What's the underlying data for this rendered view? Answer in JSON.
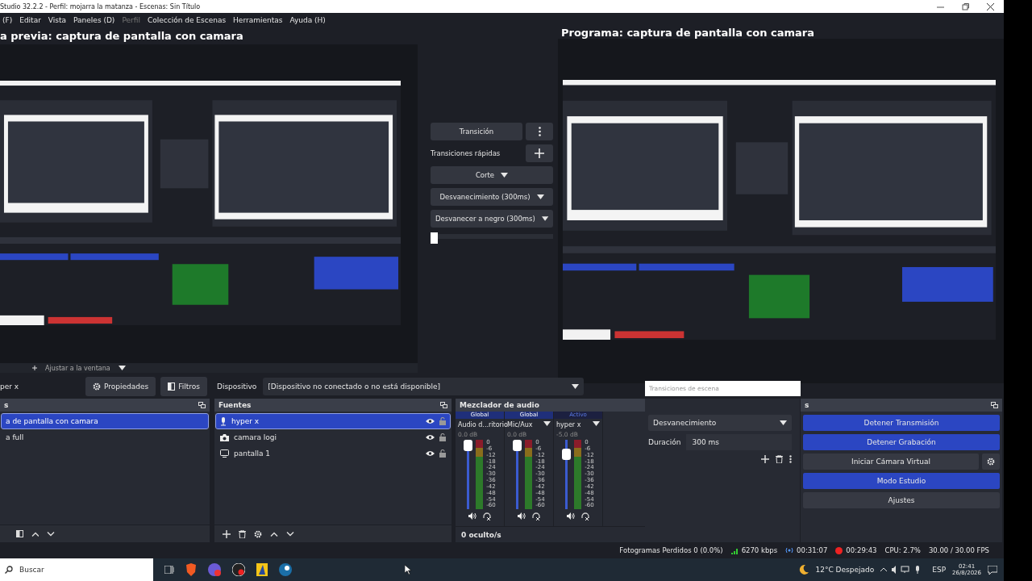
{
  "window": {
    "title": "Studio 32.2.2 - Perfil: mojarra la matanza - Escenas: Sin Título"
  },
  "menu": [
    {
      "label": "(F)",
      "disabled": false
    },
    {
      "label": "Editar",
      "disabled": false
    },
    {
      "label": "Vista",
      "disabled": false
    },
    {
      "label": "Paneles (D)",
      "disabled": false
    },
    {
      "label": "Perfil",
      "disabled": true
    },
    {
      "label": "Colección de Escenas",
      "disabled": false
    },
    {
      "label": "Herramientas",
      "disabled": false
    },
    {
      "label": "Ayuda (H)",
      "disabled": false
    }
  ],
  "preview": {
    "title": "a previa: captura de pantalla con camara"
  },
  "program": {
    "title": "Programa: captura de pantalla con camara"
  },
  "transition_panel": {
    "button": "Transición",
    "quick_label": "Transiciones rápidas",
    "quick": [
      "Corte",
      "Desvanecimiento (300ms)",
      "Desvanecer a negro (300ms)"
    ],
    "tbar": {
      "level": 0
    }
  },
  "preview_toolbar": {
    "zoom": "Ajustar a la ventana"
  },
  "source_toolbar": {
    "source": "per x",
    "buttons": [
      {
        "kind": "properties",
        "label": "Propiedades"
      },
      {
        "kind": "filters",
        "label": "Filtros"
      }
    ],
    "device_label": "Dispositivo",
    "device_value": "[Dispositivo no conectado o no está disponible]"
  },
  "scenes": {
    "title": "s",
    "items": [
      {
        "name": "a de pantalla con camara",
        "selected": true
      },
      {
        "name": "a full",
        "selected": false
      }
    ]
  },
  "sources": {
    "title": "Fuentes",
    "items": [
      {
        "name": "hyper x",
        "kind": "microphone",
        "selected": true
      },
      {
        "name": "camara logi",
        "kind": "camera",
        "selected": false
      },
      {
        "name": "pantalla 1",
        "kind": "monitor",
        "selected": false
      }
    ]
  },
  "mixer": {
    "title": "Mezclador de audio",
    "hidden": "0 oculto/s",
    "channels": [
      {
        "mode": "Global",
        "active": false,
        "name": "Audio d...ritorio",
        "reading": "0.0 dB",
        "level": 1.0,
        "scale": [
          "0",
          "-6",
          "-12",
          "-18",
          "-24",
          "-30",
          "-36",
          "-42",
          "-48",
          "-54",
          "-60"
        ]
      },
      {
        "mode": "Global",
        "active": false,
        "name": "Mic/Aux",
        "reading": "0.0 dB",
        "level": 1.0,
        "scale": [
          "0",
          "-6",
          "-12",
          "-18",
          "-24",
          "-30",
          "-36",
          "-42",
          "-48",
          "-54",
          "-60"
        ]
      },
      {
        "mode": "Activo",
        "active": true,
        "name": "hyper x",
        "reading": "-5.0 dB",
        "level": 0.85,
        "scale": [
          "0",
          "-6",
          "-12",
          "-18",
          "-24",
          "-30",
          "-36",
          "-42",
          "-48",
          "-54",
          "-60"
        ]
      }
    ]
  },
  "transitions": {
    "title": "Transiciones de escena",
    "select": "Desvanecimiento",
    "duration_label": "Duración",
    "duration": "300 ms"
  },
  "controls": {
    "title": "s",
    "buttons": [
      {
        "label": "Detener Transmisión",
        "active": true,
        "kind": "plain"
      },
      {
        "label": "Detener Grabación",
        "active": true,
        "kind": "plain"
      },
      {
        "label": "Iniciar Cámara Virtual",
        "active": false,
        "kind": "with-settings"
      },
      {
        "label": "Modo Estudio",
        "active": true,
        "kind": "plain"
      },
      {
        "label": "Ajustes",
        "active": false,
        "kind": "plain"
      }
    ]
  },
  "status": {
    "dropped": "Fotogramas Perdidos 0 (0.0%)",
    "bitrate": "6270 kbps",
    "stream_time": "00:31:07",
    "record_time": "00:29:43",
    "cpu": "CPU: 2.7%",
    "fps": "30.00 / 30.00 FPS"
  },
  "taskbar": {
    "search_placeholder": "Buscar",
    "weather": "12°C Despejado",
    "language": "ESP",
    "time": "02:41",
    "date": "26/8/2026"
  }
}
